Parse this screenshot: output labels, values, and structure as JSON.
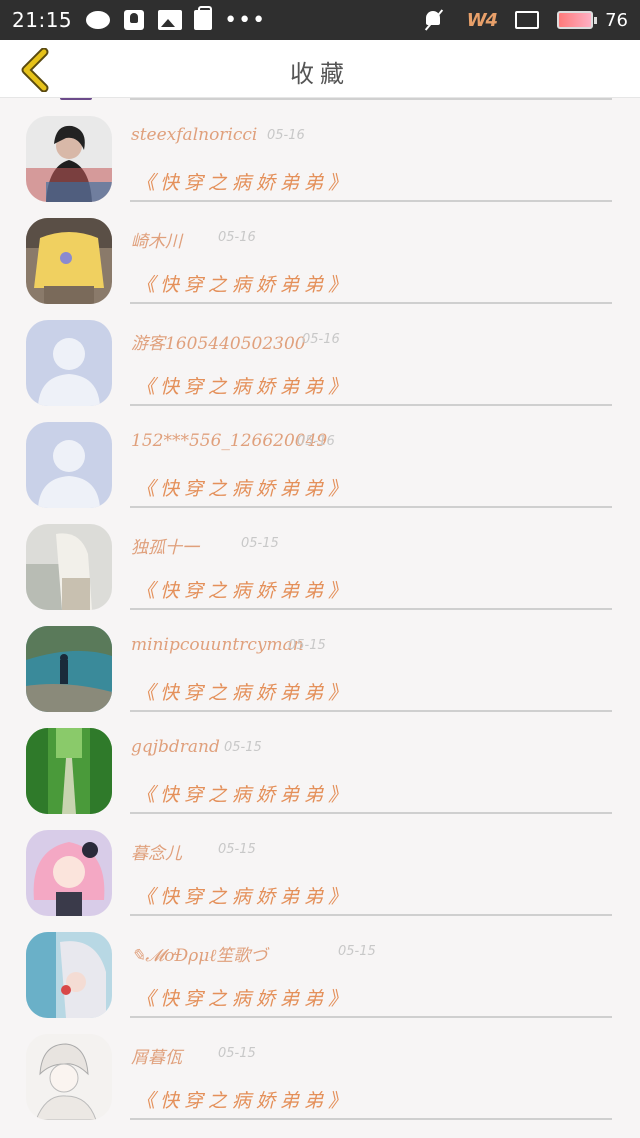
{
  "status_bar": {
    "time": "21:15",
    "dots": "•••",
    "wifi_label": "W4",
    "battery": "76"
  },
  "nav": {
    "title": "收藏"
  },
  "rows": [
    {
      "nickname": "steexfalnoricci",
      "date": "05-16",
      "book": "《快穿之病娇弟弟》",
      "avatar": "avatar-girl-photo"
    },
    {
      "nickname": "崎木川",
      "date": "05-16",
      "book": "《快穿之病娇弟弟》",
      "avatar": "avatar-yellow-shirt"
    },
    {
      "nickname": "游客1605440502300",
      "date": "05-16",
      "book": "《快穿之病娇弟弟》",
      "avatar": "default-avatar-icon"
    },
    {
      "nickname": "152***556_126620049",
      "date": "05-16",
      "book": "《快穿之病娇弟弟》",
      "avatar": "default-avatar-icon"
    },
    {
      "nickname": "独孤十一",
      "date": "05-15",
      "book": "《快穿之病娇弟弟》",
      "avatar": "avatar-person-white"
    },
    {
      "nickname": "minipcouuntrcyman",
      "date": "05-15",
      "book": "《快穿之病娇弟弟》",
      "avatar": "avatar-seaside"
    },
    {
      "nickname": "gqjbdrand",
      "date": "05-15",
      "book": "《快穿之病娇弟弟》",
      "avatar": "avatar-garden-path"
    },
    {
      "nickname": "暮念儿",
      "date": "05-15",
      "book": "《快穿之病娇弟弟》",
      "avatar": "avatar-anime-pink"
    },
    {
      "nickname": "✎𝓜ơĐρμℓ笙歌づ",
      "date": "05-15",
      "book": "《快穿之病娇弟弟》",
      "avatar": "avatar-anime-boy"
    },
    {
      "nickname": "屑暮佤",
      "date": "05-15",
      "book": "《快穿之病娇弟弟》",
      "avatar": "avatar-anime-sketch"
    }
  ],
  "colors": {
    "nickname": "#e0a07c",
    "book": "#e4905a",
    "date": "#c8c8c8",
    "back_arrow": "#e6c21a"
  }
}
